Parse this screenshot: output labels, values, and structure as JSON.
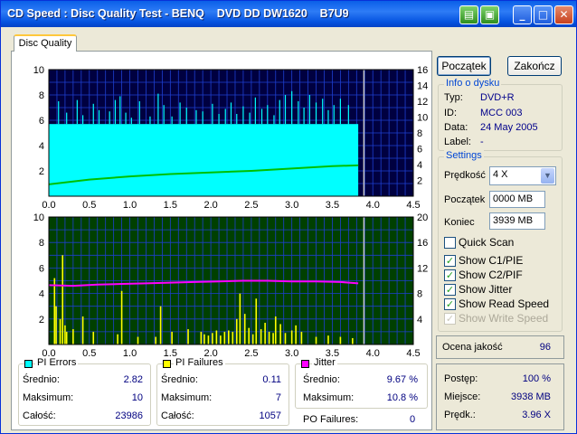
{
  "window": {
    "title": "CD Speed : Disc Quality Test - BENQ    DVD DD DW1620    B7U9"
  },
  "tabs": [
    {
      "label": "Disc Quality"
    }
  ],
  "buttons": {
    "start": "Początek",
    "exit": "Zakończ"
  },
  "disc_info": {
    "title": "Info o dysku",
    "rows": [
      {
        "label": "Typ:",
        "value": "DVD+R"
      },
      {
        "label": "ID:",
        "value": "MCC 003"
      },
      {
        "label": "Data:",
        "value": "24 May 2005"
      },
      {
        "label": "Label:",
        "value": "-"
      }
    ]
  },
  "settings": {
    "title": "Settings",
    "speed_label": "Prędkość",
    "speed_value": "4 X",
    "start_label": "Początek",
    "start_value": "0000 MB",
    "end_label": "Koniec",
    "end_value": "3939 MB",
    "checkboxes": [
      {
        "label": "Quick Scan",
        "checked": false,
        "enabled": true
      },
      {
        "label": "Show C1/PIE",
        "checked": true,
        "enabled": true
      },
      {
        "label": "Show C2/PIF",
        "checked": true,
        "enabled": true
      },
      {
        "label": "Show Jitter",
        "checked": true,
        "enabled": true
      },
      {
        "label": "Show Read Speed",
        "checked": true,
        "enabled": true
      },
      {
        "label": "Show Write Speed",
        "checked": true,
        "enabled": false
      }
    ]
  },
  "quality": {
    "label": "Ocena jakość",
    "value": "96"
  },
  "progress": {
    "rows": [
      {
        "label": "Postęp:",
        "value": "100 %"
      },
      {
        "label": "Miejsce:",
        "value": "3938 MB"
      },
      {
        "label": "Prędk.:",
        "value": "3.96 X"
      }
    ]
  },
  "stats": {
    "pi_errors": {
      "title": "PI Errors",
      "color": "#00FFFF",
      "rows": [
        {
          "label": "Średnio:",
          "value": "2.82"
        },
        {
          "label": "Maksimum:",
          "value": "10"
        },
        {
          "label": "Całość:",
          "value": "23986"
        }
      ]
    },
    "pi_failures": {
      "title": "PI Failures",
      "color": "#FFFF00",
      "rows": [
        {
          "label": "Średnio:",
          "value": "0.11"
        },
        {
          "label": "Maksimum:",
          "value": "7"
        },
        {
          "label": "Całość:",
          "value": "1057"
        }
      ]
    },
    "jitter": {
      "title": "Jitter",
      "color": "#FF00FF",
      "rows": [
        {
          "label": "Średnio:",
          "value": "9.67 %"
        },
        {
          "label": "Maksimum:",
          "value": "10.8 %"
        }
      ]
    },
    "po_failures": {
      "label": "PO Failures:",
      "value": "0"
    }
  },
  "chart_data": [
    {
      "type": "bar",
      "name": "PI Errors chart",
      "x_ticks": [
        "0.0",
        "0.5",
        "1.0",
        "1.5",
        "2.0",
        "2.5",
        "3.0",
        "3.5",
        "4.0",
        "4.5"
      ],
      "xlim": [
        0,
        4.5
      ],
      "ylim_left": [
        0,
        10
      ],
      "y_ticks_left": [
        "2",
        "4",
        "6",
        "8",
        "10"
      ],
      "ylim_right": [
        0,
        16
      ],
      "y_ticks_right": [
        "2",
        "4",
        "6",
        "8",
        "10",
        "12",
        "14",
        "16"
      ],
      "background": "#000040",
      "series": [
        {
          "name": "PI Errors",
          "color": "#00FFFF",
          "base_level": 5.7,
          "end_x": 3.82,
          "spikes": [
            [
              0.12,
              7.5
            ],
            [
              0.22,
              6.6
            ],
            [
              0.35,
              7.6
            ],
            [
              0.42,
              6.4
            ],
            [
              0.55,
              7.3
            ],
            [
              0.62,
              6.8
            ],
            [
              0.75,
              6.7
            ],
            [
              0.82,
              7.6
            ],
            [
              0.88,
              7.9
            ],
            [
              0.95,
              6.6
            ],
            [
              1.02,
              6.2
            ],
            [
              1.12,
              7.5
            ],
            [
              1.25,
              6.3
            ],
            [
              1.35,
              8.1
            ],
            [
              1.42,
              7.2
            ],
            [
              1.52,
              6.3
            ],
            [
              1.62,
              7.4
            ],
            [
              1.7,
              7.0
            ],
            [
              1.82,
              6.8
            ],
            [
              1.9,
              6.7
            ],
            [
              2.02,
              7.3
            ],
            [
              2.1,
              6.5
            ],
            [
              2.18,
              6.9
            ],
            [
              2.25,
              7.4
            ],
            [
              2.32,
              6.5
            ],
            [
              2.4,
              7.1
            ],
            [
              2.48,
              6.6
            ],
            [
              2.55,
              7.8
            ],
            [
              2.63,
              6.9
            ],
            [
              2.7,
              7.2
            ],
            [
              2.78,
              6.4
            ],
            [
              2.85,
              7.6
            ],
            [
              2.92,
              8.0
            ],
            [
              3.0,
              8.3
            ],
            [
              3.08,
              7.5
            ],
            [
              3.15,
              7.0
            ],
            [
              3.22,
              8.0
            ],
            [
              3.3,
              7.4
            ],
            [
              3.38,
              7.7
            ],
            [
              3.45,
              6.8
            ],
            [
              3.52,
              7.2
            ],
            [
              3.6,
              7.7
            ],
            [
              3.7,
              7.2
            ]
          ]
        },
        {
          "name": "Read Speed",
          "color": "#00C000",
          "axis": "right",
          "points": [
            [
              0.0,
              1.5
            ],
            [
              0.5,
              2.1
            ],
            [
              1.0,
              2.5
            ],
            [
              1.5,
              2.8
            ],
            [
              2.0,
              3.0
            ],
            [
              2.5,
              3.2
            ],
            [
              3.0,
              3.5
            ],
            [
              3.5,
              3.8
            ],
            [
              3.82,
              3.9
            ]
          ]
        }
      ]
    },
    {
      "type": "bar",
      "name": "PI Failures chart",
      "x_ticks": [
        "0.0",
        "0.5",
        "1.0",
        "1.5",
        "2.0",
        "2.5",
        "3.0",
        "3.5",
        "4.0",
        "4.5"
      ],
      "xlim": [
        0,
        4.5
      ],
      "ylim_left": [
        0,
        10
      ],
      "y_ticks_left": [
        "2",
        "4",
        "6",
        "8",
        "10"
      ],
      "ylim_right": [
        0,
        20
      ],
      "y_ticks_right": [
        "4",
        "8",
        "12",
        "16",
        "20"
      ],
      "background": "#004000",
      "series": [
        {
          "name": "PI Failures",
          "color": "#FFFF00",
          "values": [
            [
              0.07,
              5.2
            ],
            [
              0.09,
              3.0
            ],
            [
              0.14,
              2.0
            ],
            [
              0.17,
              7.0
            ],
            [
              0.2,
              1.5
            ],
            [
              0.22,
              1.0
            ],
            [
              0.3,
              1.2
            ],
            [
              0.42,
              2.2
            ],
            [
              0.55,
              1.0
            ],
            [
              0.85,
              0.8
            ],
            [
              0.9,
              4.2
            ],
            [
              1.1,
              0.6
            ],
            [
              1.32,
              0.6
            ],
            [
              1.38,
              3.0
            ],
            [
              1.52,
              1.0
            ],
            [
              1.72,
              1.2
            ],
            [
              1.88,
              1.0
            ],
            [
              1.92,
              0.8
            ],
            [
              1.97,
              0.7
            ],
            [
              2.02,
              0.9
            ],
            [
              2.07,
              1.1
            ],
            [
              2.12,
              0.7
            ],
            [
              2.17,
              1.0
            ],
            [
              2.22,
              1.1
            ],
            [
              2.27,
              1.0
            ],
            [
              2.32,
              2.0
            ],
            [
              2.36,
              4.0
            ],
            [
              2.42,
              2.4
            ],
            [
              2.47,
              1.3
            ],
            [
              2.52,
              0.8
            ],
            [
              2.56,
              3.6
            ],
            [
              2.62,
              1.2
            ],
            [
              2.67,
              1.7
            ],
            [
              2.72,
              1.0
            ],
            [
              2.77,
              0.9
            ],
            [
              2.8,
              2.2
            ],
            [
              2.86,
              1.6
            ],
            [
              2.92,
              0.9
            ],
            [
              3.0,
              1.1
            ],
            [
              3.05,
              1.5
            ],
            [
              3.12,
              1.0
            ],
            [
              3.3,
              0.6
            ],
            [
              3.45,
              0.7
            ],
            [
              3.6,
              0.6
            ],
            [
              3.75,
              0.5
            ]
          ]
        },
        {
          "name": "Jitter",
          "color": "#FF00FF",
          "axis": "right",
          "points": [
            [
              0.0,
              9.3
            ],
            [
              0.3,
              9.2
            ],
            [
              0.6,
              9.4
            ],
            [
              0.9,
              9.5
            ],
            [
              1.2,
              9.6
            ],
            [
              1.5,
              9.7
            ],
            [
              1.8,
              9.8
            ],
            [
              2.1,
              9.9
            ],
            [
              2.4,
              10.0
            ],
            [
              2.7,
              10.0
            ],
            [
              3.0,
              9.9
            ],
            [
              3.3,
              9.9
            ],
            [
              3.6,
              9.8
            ],
            [
              3.82,
              9.6
            ]
          ]
        }
      ]
    }
  ]
}
